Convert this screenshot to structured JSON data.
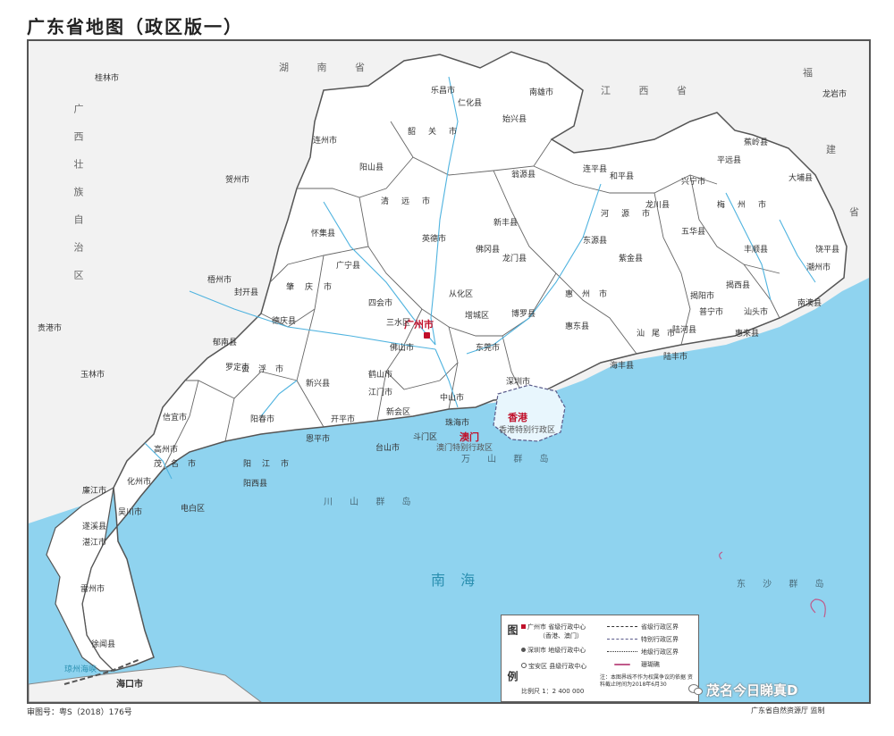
{
  "title": "广东省地图（政区版一）",
  "colors": {
    "sea": "#8fd3ef",
    "land": "#ffffff",
    "neighbor": "#f2f2f2",
    "border": "#555555",
    "river": "#4fb3df",
    "capital": "#c0102a"
  },
  "neighbors": {
    "hunan": "湖 南 省",
    "jiangxi": "江 西 省",
    "fujian_a": "福",
    "fujian_b": "建",
    "fujian_c": "省",
    "guangxi": "广西壮族自治区"
  },
  "seas": {
    "south_china_sea": "南        海"
  },
  "islands": {
    "dongsha": "东 沙 群 岛",
    "wanshan": "万 山 群 岛",
    "chuanshan": "川 山 群 岛"
  },
  "capital": "广州市",
  "sar": {
    "hongkong": "香港",
    "hk_zone": "香港特别行政区",
    "macau": "澳门",
    "macau_zone": "澳门特别行政区"
  },
  "cities": [
    "韶关市",
    "清远市",
    "河源市",
    "梅州市",
    "潮州市",
    "揭阳市",
    "汕头市",
    "汕尾市",
    "惠州市",
    "东莞市",
    "深圳市",
    "珠海市",
    "中山市",
    "江门市",
    "佛山市",
    "肇庆市",
    "云浮市",
    "阳江市",
    "茂名市",
    "湛江市"
  ],
  "others": {
    "guilin": "桂林市",
    "hezhou": "贺州市",
    "wuzhou": "梧州市",
    "yulin": "玉林市",
    "guigang": "贵港市",
    "longyan": "龙岩市",
    "haikou": "海口市",
    "qiongzhou": "琼州海峡"
  },
  "counties": [
    "乐昌市",
    "仁化县",
    "南雄市",
    "始兴县",
    "翁源县",
    "新丰县",
    "连州市",
    "阳山县",
    "英德市",
    "佛冈县",
    "连平县",
    "和平县",
    "龙川县",
    "紫金县",
    "兴宁市",
    "平远县",
    "蕉岭县",
    "大埔县",
    "丰顺县",
    "五华县",
    "饶平县",
    "普宁市",
    "惠来县",
    "陆丰市",
    "海丰县",
    "惠东县",
    "博罗县",
    "增城区",
    "从化区",
    "怀集县",
    "广宁县",
    "四会市",
    "德庆县",
    "封开县",
    "罗定市",
    "新兴县",
    "郁南县",
    "台山市",
    "开平市",
    "恩平市",
    "阳春市",
    "阳西县",
    "电白区",
    "信宜市",
    "高州市",
    "化州市",
    "廉江市",
    "遂溪县",
    "雷州市",
    "徐闻县",
    "吴川市",
    "鹤山市",
    "龙门县",
    "南澳县",
    "揭西县",
    "陆河县",
    "东源县",
    "新会区",
    "斗门区",
    "三水区"
  ],
  "legend": {
    "label": "图 例",
    "row1": "广州市  省级行政中心",
    "row1b": "（香港、澳门）",
    "row2": "深圳市  地级行政中心",
    "row3": "宝安区  县级行政中心",
    "line1": "省级行政区界",
    "line2": "特别行政区界",
    "line3": "地级行政区界",
    "line4": "珊瑚礁",
    "scale": "比例尺  1：2 400 000",
    "note": "注：本图界线不作为权属争议的依据 资料截止时间为2018年6月30"
  },
  "footer": {
    "review": "审图号：粤S（2018）176号",
    "maker": "广东省自然资源厅  监制"
  },
  "watermark": "茂名今日睇真D"
}
